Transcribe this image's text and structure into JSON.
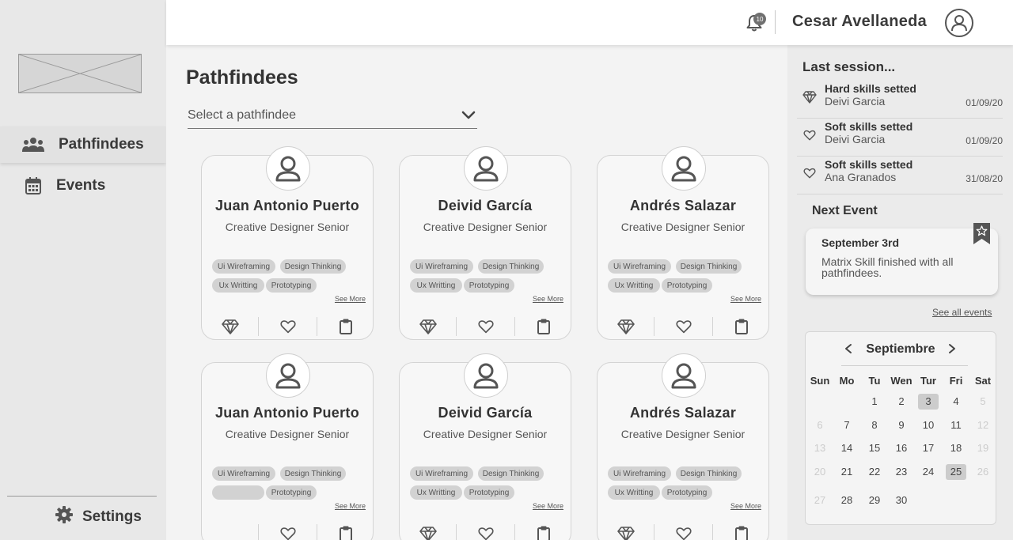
{
  "header": {
    "notification_count": "10",
    "user_name": "Cesar Avellaneda"
  },
  "sidebar": {
    "items": [
      {
        "label": "Pathfindees",
        "icon": "users-icon",
        "active": true
      },
      {
        "label": "Events",
        "icon": "calendar-icon",
        "active": false
      }
    ],
    "settings_label": "Settings"
  },
  "main": {
    "title": "Pathfindees",
    "select_placeholder": "Select a pathfindee",
    "see_more_label": "See More",
    "cards": [
      {
        "name": "Juan Antonio Puerto",
        "role": "Creative Designer Senior",
        "tags": [
          "Ui Wireframing",
          "Design Thinking",
          "Ux Writting",
          "Prototyping"
        ]
      },
      {
        "name": "Deivid García",
        "role": "Creative Designer Senior",
        "tags": [
          "Ui Wireframing",
          "Design Thinking",
          "Ux Writting",
          "Prototyping"
        ]
      },
      {
        "name": "Andrés Salazar",
        "role": "Creative Designer Senior",
        "tags": [
          "Ui Wireframing",
          "Design Thinking",
          "Ux Writting",
          "Prototyping"
        ]
      },
      {
        "name": "Juan Antonio Puerto",
        "role": "Creative Designer Senior",
        "tags": [
          "Ui Wireframing",
          "Design Thinking",
          "",
          "Prototyping"
        ]
      },
      {
        "name": "Deivid García",
        "role": "Creative Designer Senior",
        "tags": [
          "Ui Wireframing",
          "Design Thinking",
          "Ux Writting",
          "Prototyping"
        ]
      },
      {
        "name": "Andrés Salazar",
        "role": "Creative Designer Senior",
        "tags": [
          "Ui Wireframing",
          "Design Thinking",
          "Ux Writting",
          "Prototyping"
        ]
      }
    ]
  },
  "right_panel": {
    "last_session_title": "Last session...",
    "sessions": [
      {
        "icon": "diamond-icon",
        "title": "Hard skills setted",
        "name": "Deivi Garcia",
        "date": "01/09/20"
      },
      {
        "icon": "heart-icon",
        "title": "Soft skills setted",
        "name": "Deivi Garcia",
        "date": "01/09/20"
      },
      {
        "icon": "heart-icon",
        "title": "Soft skills setted",
        "name": "Ana Granados",
        "date": "31/08/20"
      }
    ],
    "next_event_title": "Next Event",
    "event": {
      "date": "September 3rd",
      "description": "Matrix Skill finished with all pathfindees."
    },
    "see_all_label": "See all events",
    "calendar": {
      "month": "Septiembre",
      "weekdays": [
        "Sun",
        "Mo",
        "Tu",
        "Wen",
        "Tur",
        "Fri",
        "Sat"
      ],
      "weeks": [
        [
          "",
          "",
          "1",
          "2",
          "3",
          "4",
          "5"
        ],
        [
          "6",
          "7",
          "8",
          "9",
          "10",
          "11",
          "12"
        ],
        [
          "13",
          "14",
          "15",
          "16",
          "17",
          "18",
          "19"
        ],
        [
          "20",
          "21",
          "22",
          "23",
          "24",
          "25",
          "26"
        ],
        [
          "27",
          "28",
          "29",
          "30",
          "",
          "",
          ""
        ]
      ],
      "highlighted": [
        "3",
        "25"
      ]
    }
  },
  "colors": {
    "sidebar_bg": "#e8e8e8",
    "tag_bg": "#d2d2d2",
    "highlight": "#cccccc"
  }
}
